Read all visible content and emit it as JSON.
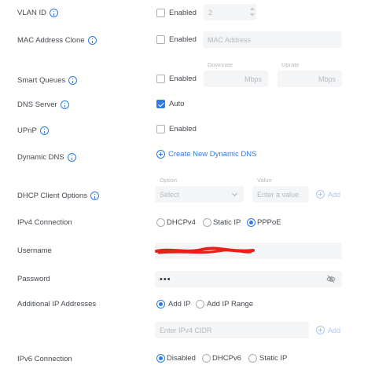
{
  "fields": {
    "vlan_id": {
      "label": "VLAN ID",
      "checkbox_label": "Enabled",
      "enabled": false,
      "value": "2"
    },
    "mac_clone": {
      "label": "MAC Address Clone",
      "checkbox_label": "Enabled",
      "enabled": false,
      "placeholder": "MAC Address"
    },
    "smart_queues": {
      "label": "Smart Queues",
      "checkbox_label": "Enabled",
      "enabled": false,
      "downrate_label": "Downrate",
      "uprate_label": "Uprate",
      "downrate_unit": "Mbps",
      "uprate_unit": "Mbps"
    },
    "dns_server": {
      "label": "DNS Server",
      "checkbox_label": "Auto",
      "checked": true
    },
    "upnp": {
      "label": "UPnP",
      "checkbox_label": "Enabled",
      "enabled": false
    },
    "dynamic_dns": {
      "label": "Dynamic DNS",
      "link": "Create New Dynamic DNS"
    },
    "dhcp_client_options": {
      "label": "DHCP Client Options",
      "option_label": "Option",
      "value_label": "Value",
      "select_placeholder": "Select",
      "value_placeholder": "Enter a value",
      "add_label": "Add"
    },
    "ipv4_connection": {
      "label": "IPv4 Connection",
      "options": [
        "DHCPv4",
        "Static IP",
        "PPPoE"
      ],
      "selected": "PPPoE"
    },
    "username": {
      "label": "Username",
      "value_redacted": true
    },
    "password": {
      "label": "Password",
      "value": "•••"
    },
    "additional_ip": {
      "label": "Additional IP Addresses",
      "options": [
        "Add IP",
        "Add IP Range"
      ],
      "selected": "Add IP",
      "placeholder": "Enter IPv4 CIDR",
      "add_label": "Add"
    },
    "ipv6_connection": {
      "label": "IPv6 Connection",
      "options": [
        "Disabled",
        "DHCPv6",
        "Static IP"
      ],
      "selected": "Disabled"
    }
  },
  "colors": {
    "accent": "#2d7be5",
    "redaction": "#e8201a",
    "input_bg": "#f4f5f6"
  },
  "icons": {
    "info": "info-icon",
    "plus": "plus-circle-icon",
    "eye": "eye-slash-icon",
    "chevron": "chevron-down-icon"
  }
}
